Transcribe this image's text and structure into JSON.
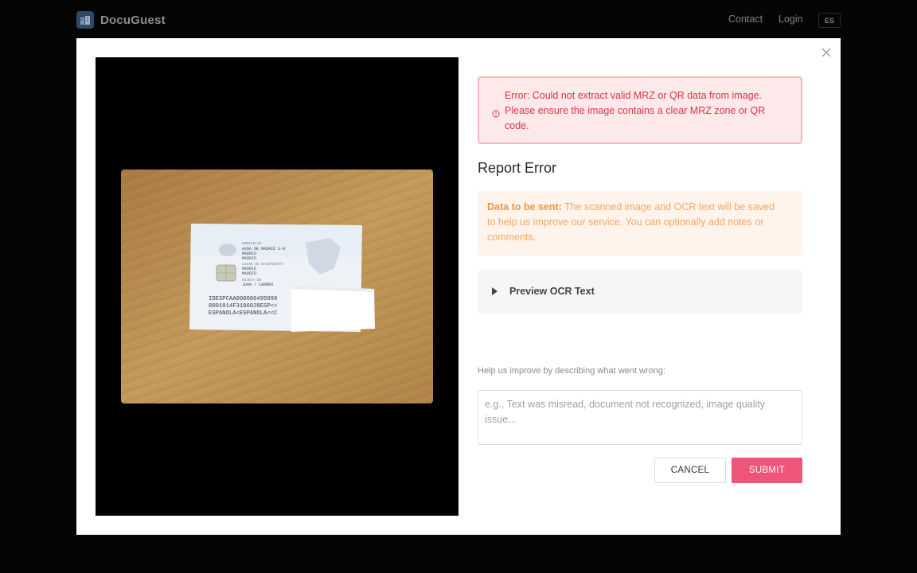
{
  "header": {
    "brand": "DocuGuest",
    "nav": {
      "contact": "Contact",
      "login": "Login",
      "language": "ES"
    }
  },
  "modal": {
    "error_message": "Error: Could not extract valid MRZ or QR data from image. Please ensure the image contains a clear MRZ zone or QR code.",
    "report_title": "Report Error",
    "info_label": "Data to be sent:",
    "info_text": " The scanned image and OCR text will be saved to help us improve our service. You can optionally add notes or comments.",
    "preview_label": "Preview OCR Text",
    "help_label": "Help us improve by describing what went wrong:",
    "notes_placeholder": "e.g., Text was misread, document not recognized, image quality issue...",
    "notes_value": "",
    "cancel_label": "CANCEL",
    "submit_label": "SUBMIT",
    "id_card_text": {
      "address_line1": "AVDA DE MADRID S-N",
      "address_line2": "MADRID",
      "address_line3": "MADRID",
      "birthplace_line1": "MADRID",
      "birthplace_line2": "MADRID",
      "parents": "JUAN / CARMEN",
      "mrz_line1": "IDESPCAA000000499999",
      "mrz_line2": "8001014F3106028ESP<<",
      "mrz_line3": "ESPANOLA<ESPANOLA<<C"
    }
  },
  "colors": {
    "overlay": "#050505",
    "error_bg": "#fde9ea",
    "error_text": "#dc3545",
    "info_bg": "#fff4ec",
    "info_text": "#f5a868",
    "submit": "#ee5579"
  },
  "icons": {
    "logo": "building-icon",
    "close": "close-icon",
    "error": "info-circle-icon",
    "preview": "caret-right-icon"
  }
}
